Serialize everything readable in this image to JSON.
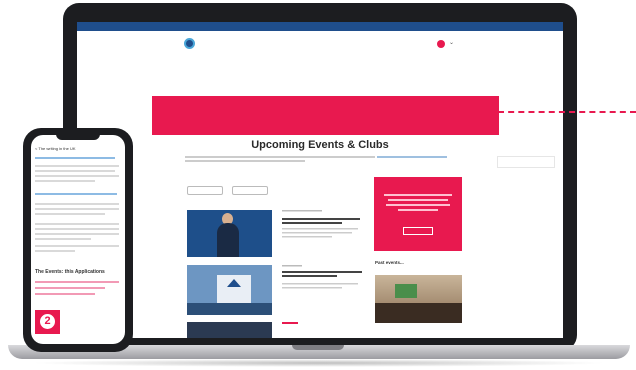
{
  "site": {
    "topbar_left": "",
    "topbar_right": "",
    "logo_text": "",
    "nav": [
      {
        "label": "",
        "active": false
      },
      {
        "label": "",
        "active": false
      },
      {
        "label": "",
        "active": false
      },
      {
        "label": "",
        "active": true
      },
      {
        "label": "",
        "active": false
      },
      {
        "label": "",
        "active": false
      }
    ],
    "page_title": "Upcoming Events & Clubs",
    "filters": [
      "",
      ""
    ],
    "promo": {
      "title": "",
      "text": "",
      "button": ""
    },
    "photo_heading": "Past events..."
  },
  "phone": {
    "back_label": "< The writing in the UK",
    "section_heading": "The Events: this Applications"
  },
  "step_badge": "2",
  "colors": {
    "accent": "#e8194f",
    "brand": "#1f4e8c",
    "device": "#1c1d20"
  }
}
